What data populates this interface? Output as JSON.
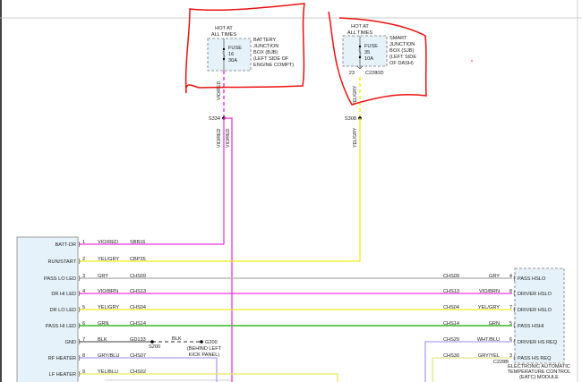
{
  "colors": {
    "vio_red": "#f035e0",
    "yel_gry": "#eeee22",
    "gry": "#aaaaaa",
    "grn": "#33bb22",
    "blk": "#666666",
    "gry_blu": "#9a8ef0",
    "yel_blu": "#e8e866",
    "wht_blu": "#9a8ef0",
    "gry_yel": "#e4e48a",
    "module_fill": "#e6f2fa",
    "annotation": "#ee1111"
  },
  "bjb": {
    "hot_line1": "HOT AT",
    "hot_line2": "ALL TIMES",
    "fuse": "FUSE",
    "fuse_no": "16",
    "fuse_amp": "30A",
    "label": [
      "BATTERY",
      "JUNCTION",
      "BOX (BJB)",
      "(LEFT SIDE OF",
      "ENGINE COMPT)"
    ],
    "wire": "VIO/RED"
  },
  "sjb": {
    "hot_line1": "HOT AT",
    "hot_line2": "ALL TIMES",
    "fuse": "FUSE",
    "fuse_no": "35",
    "fuse_amp": "10A",
    "label": [
      "SMART",
      "JUNCTION",
      "BOX (SJB)",
      "(LEFT SIDE",
      "OF DASH)"
    ],
    "pin": "23",
    "connector": "C2280D",
    "wire": "YEL/GRY"
  },
  "splices": {
    "s334": "S334",
    "s308": "S308",
    "s334_wire_a": "VIO/RED",
    "s334_wire_b": "VIO/RED",
    "s308_wire": "YEL/GRY"
  },
  "left_module": {
    "rows": [
      {
        "label": "BATT-DR",
        "pin": "1",
        "wire": "VIO/RED",
        "circuit": "SBB16"
      },
      {
        "label": "RUN/START",
        "pin": "2",
        "wire": "YEL/GRY",
        "circuit": "CBP35"
      },
      {
        "label": "PASS LO LED",
        "pin": "3",
        "wire": "GRY",
        "circuit": "CHS09"
      },
      {
        "label": "DR HI LED",
        "pin": "4",
        "wire": "VIO/BRN",
        "circuit": "CHS13"
      },
      {
        "label": "DR LO LED",
        "pin": "5",
        "wire": "YEL/GRY",
        "circuit": "CHS04"
      },
      {
        "label": "PASS HI LED",
        "pin": "6",
        "wire": "GRN",
        "circuit": "CHS14"
      },
      {
        "label": "GND",
        "pin": "7",
        "wire": "BLK",
        "circuit": "GD133"
      },
      {
        "label": "RF HEATER",
        "pin": "8",
        "wire": "GRY/BLU",
        "circuit": "CHS07"
      },
      {
        "label": "LF HEATER",
        "pin": "9",
        "wire": "YEL/BLU",
        "circuit": "CHS02"
      }
    ]
  },
  "ground": {
    "splice": "S200",
    "wire": "BLK",
    "point": "G200",
    "loc1": "(BEHIND LEFT",
    "loc2": "KICK PANEL)"
  },
  "right_module": {
    "rows": [
      {
        "label": "PASS HSLO",
        "pin": "4",
        "wire": "GRY",
        "circuit": "CHS09"
      },
      {
        "label": "DRIVER HSLO",
        "pin": "8",
        "wire": "VIO/BRN",
        "circuit": "CHS13"
      },
      {
        "label": "DRIVER HSLO",
        "pin": "7",
        "wire": "YEL/GRY",
        "circuit": "CHS04"
      },
      {
        "label": "PASS HSHI",
        "pin": "5",
        "wire": "GRN",
        "circuit": "CHS14"
      },
      {
        "label": "DRIVER HS REQ",
        "pin": "6",
        "wire": "WHT/BLU",
        "circuit": "CHS29"
      },
      {
        "label": "PASS HS REQ",
        "pin": "3",
        "wire": "GRY/YEL",
        "circuit": "CHS30"
      }
    ],
    "connector": "C228B",
    "name": [
      "ELECTRONIC AUTOMATIC",
      "TEMPERATURE CONTROL",
      "(EATC) MODULE"
    ]
  }
}
